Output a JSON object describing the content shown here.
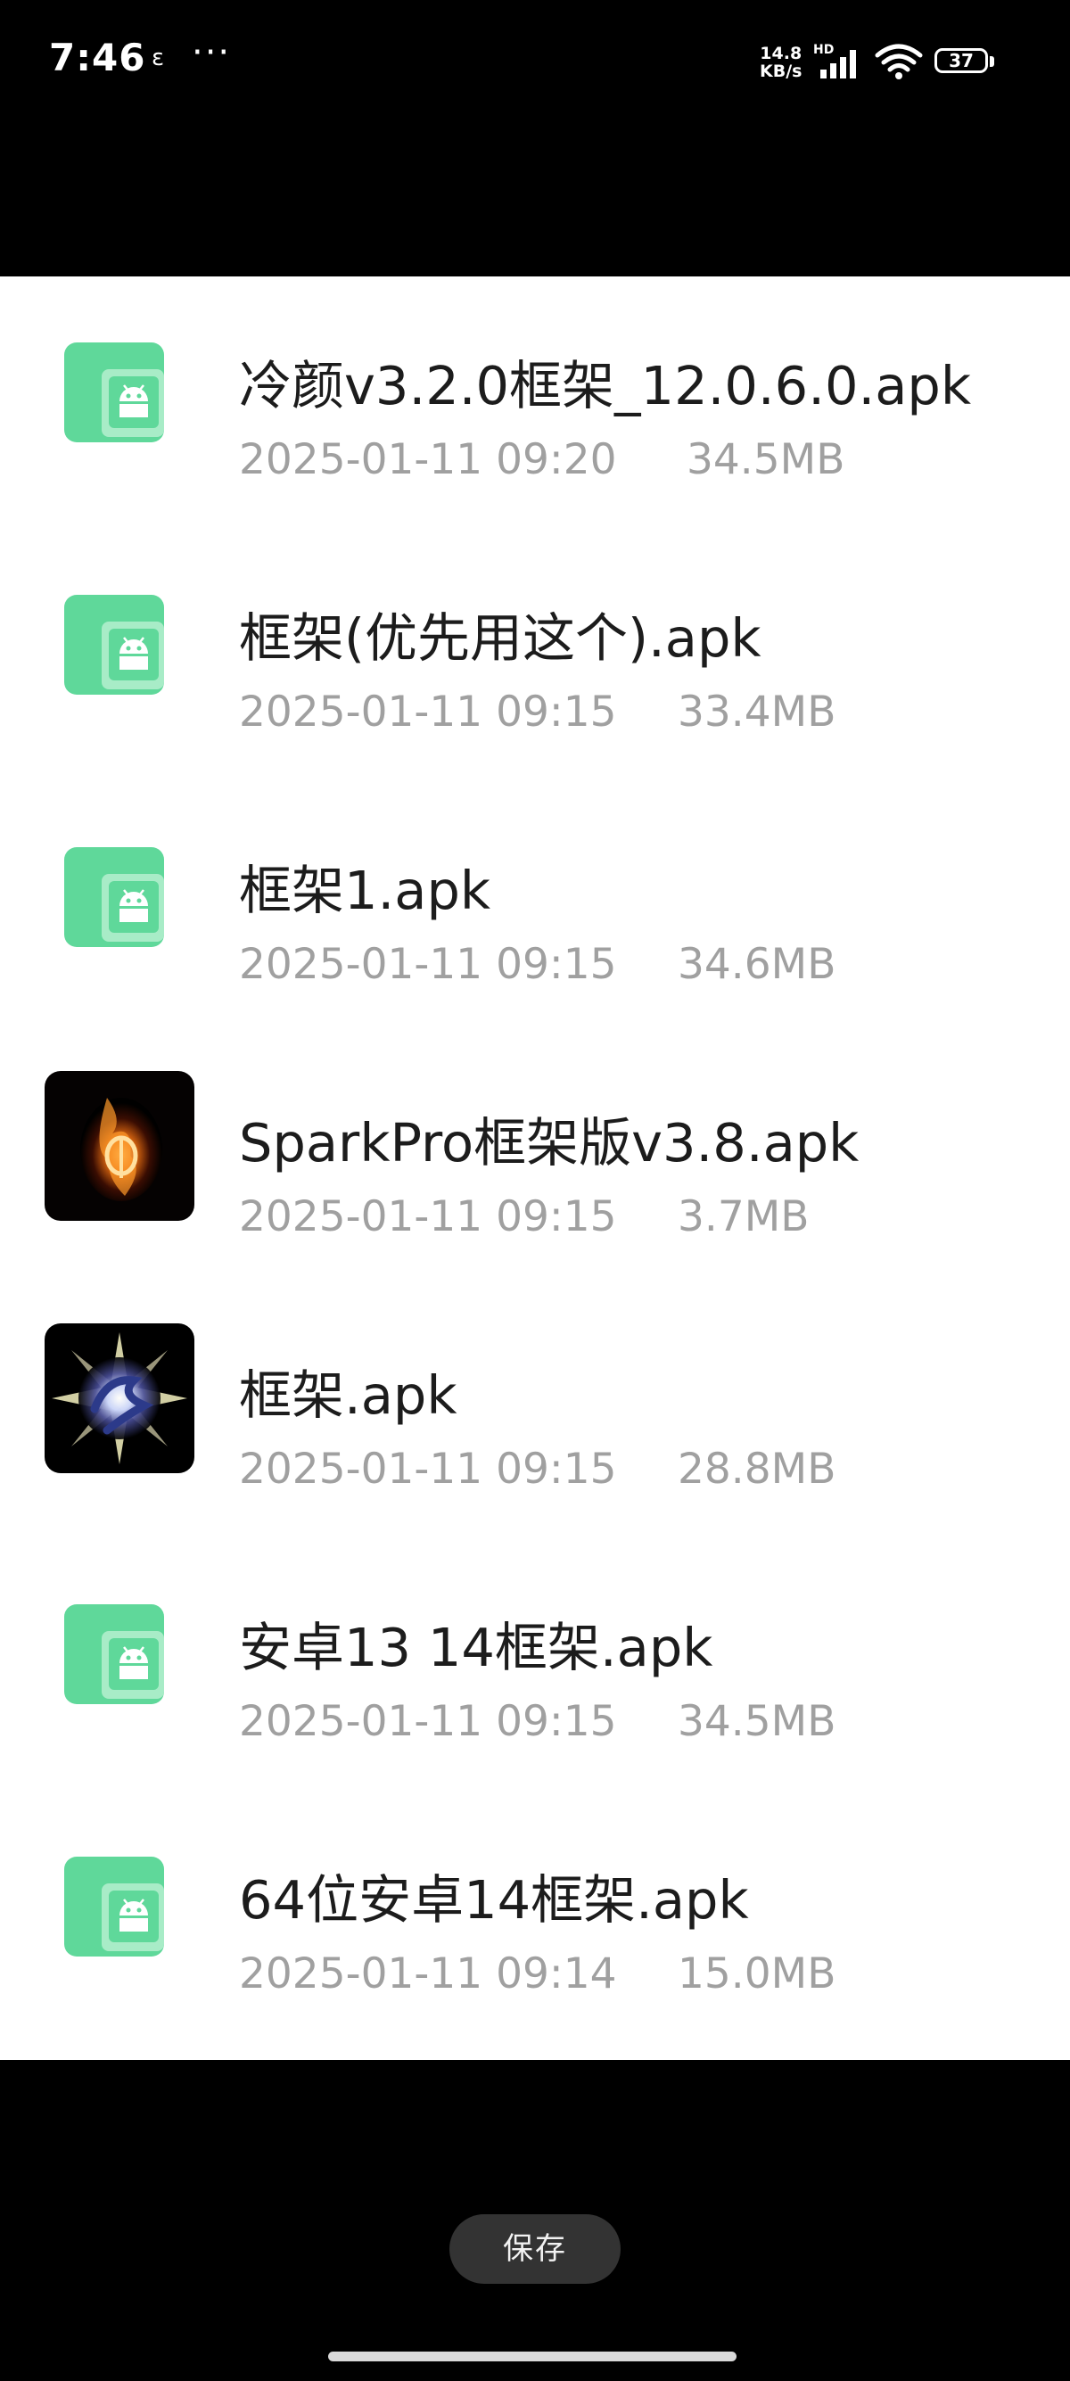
{
  "status_bar": {
    "time": "7:46",
    "notification_icon": "ɛ",
    "more": "···",
    "net_speed_value": "14.8",
    "net_speed_unit": "KB/s",
    "hd": "HD",
    "battery": "37",
    "icons": [
      "signal-icon",
      "wifi-icon",
      "battery-icon"
    ]
  },
  "files": [
    {
      "name": "冷颜v3.2.0框架_12.0.6.0.apk",
      "date": "2025-01-11 09:20",
      "size": "34.5MB",
      "icon": "android-apk-icon"
    },
    {
      "name": "框架(优先用这个).apk",
      "date": "2025-01-11 09:15",
      "size": "33.4MB",
      "icon": "android-apk-icon"
    },
    {
      "name": "框架1.apk",
      "date": "2025-01-11 09:15",
      "size": "34.6MB",
      "icon": "android-apk-icon"
    },
    {
      "name": "SparkPro框架版v3.8.apk",
      "date": "2025-01-11 09:15",
      "size": "3.7MB",
      "icon": "fire-app-icon"
    },
    {
      "name": "框架.apk",
      "date": "2025-01-11 09:15",
      "size": "28.8MB",
      "icon": "light-burst-app-icon"
    },
    {
      "name": "安卓13 14框架.apk",
      "date": "2025-01-11 09:15",
      "size": "34.5MB",
      "icon": "android-apk-icon"
    },
    {
      "name": "64位安卓14框架.apk",
      "date": "2025-01-11 09:14",
      "size": "15.0MB",
      "icon": "android-apk-icon"
    }
  ],
  "actions": {
    "save_label": "保存"
  },
  "colors": {
    "apk_icon_green": "#5fd89a",
    "sheet_bg": "#ffffff",
    "screen_bg": "#000000"
  }
}
